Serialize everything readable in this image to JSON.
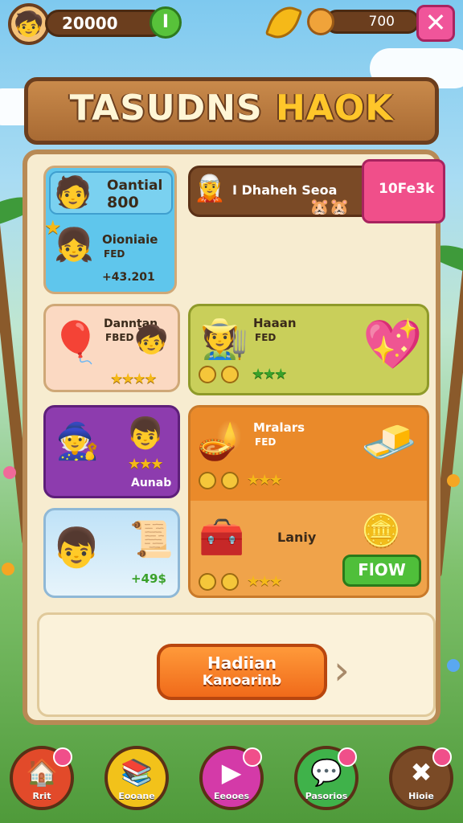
{
  "topbar": {
    "coins": "20000",
    "green_button": "I",
    "resource_value": "700",
    "close_label": "✕"
  },
  "title": {
    "part1": "TASUDNS",
    "part2": "HAOK"
  },
  "cards": [
    {
      "id": "c1",
      "title": "Oantial",
      "value": "800",
      "sub_title": "Oioniaie",
      "sub_label": "FED",
      "price": "+43.201"
    },
    {
      "id": "c2",
      "title": "I Dhaheh Seoa",
      "badge": "10Fe3k"
    },
    {
      "id": "c3",
      "title": "Danntan",
      "label": "FBED"
    },
    {
      "id": "c4",
      "title": "Haaan",
      "label": "FED"
    },
    {
      "id": "c5",
      "label": "Aunab"
    },
    {
      "id": "c6",
      "title": "Mralars",
      "label": "FED",
      "item2": "Laniy",
      "button": "FlOW"
    },
    {
      "id": "c7",
      "price": "+49$"
    }
  ],
  "main_button": {
    "line1": "Hadiian",
    "line2": "Kanoarinb"
  },
  "nav": [
    {
      "label": "Rrit",
      "icon": "home-icon",
      "color": "#e24a2a"
    },
    {
      "label": "Eooane",
      "icon": "books-icon",
      "color": "#f2c21a"
    },
    {
      "label": "Eeooes",
      "icon": "play-icon",
      "color": "#d43aa8"
    },
    {
      "label": "Pasorios",
      "icon": "chat-icon",
      "color": "#3fb24a"
    },
    {
      "label": "Hioie",
      "icon": "settings-icon",
      "color": "#7a4a26"
    }
  ]
}
